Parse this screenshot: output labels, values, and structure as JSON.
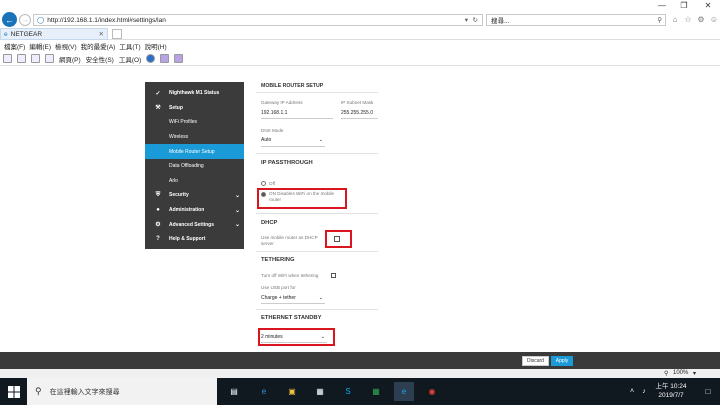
{
  "browser": {
    "url": "http://192.168.1.1/index.html#settings/lan",
    "search_placeholder": "搜尋...",
    "tab_title": "NETGEAR",
    "menu": [
      "檔案(F)",
      "編輯(E)",
      "檢視(V)",
      "我的最愛(A)",
      "工具(T)",
      "說明(H)"
    ],
    "commands": {
      "page": "網頁(P)",
      "safety": "安全性(S)",
      "tools": "工具(O)"
    },
    "zoom": "100%",
    "window_controls": {
      "minimize": "—",
      "maximize": "❐",
      "close": "✕"
    }
  },
  "sidebar": {
    "items": [
      {
        "label": "Nighthawk M1 Status",
        "icon": "status-icon"
      },
      {
        "label": "Setup",
        "icon": "wrench-icon"
      },
      {
        "label": "WiFi Profiles"
      },
      {
        "label": "Wireless"
      },
      {
        "label": "Mobile Router Setup"
      },
      {
        "label": "Data Offloading"
      },
      {
        "label": "Arlo"
      },
      {
        "label": "Security",
        "icon": "shield-icon"
      },
      {
        "label": "Administration",
        "icon": "user-icon"
      },
      {
        "label": "Advanced Settings",
        "icon": "gear-icon"
      },
      {
        "label": "Help & Support",
        "icon": "help-icon"
      }
    ]
  },
  "content": {
    "title": "MOBILE ROUTER SETUP",
    "gateway_label": "Gateway IP Address",
    "gateway_value": "192.168.1.1",
    "subnet_label": "IP Subnet Mask",
    "subnet_value": "255.255.255.0",
    "dns_label": "DNS Mode",
    "dns_value": "Auto",
    "passthrough_title": "IP PASSTHROUGH",
    "passthrough_off": "Off",
    "passthrough_on": "ON Disables WiFi on the mobile router",
    "dhcp_title": "DHCP",
    "dhcp_label": "Use mobile router as DHCP server",
    "tethering_title": "TETHERING",
    "tethering_label": "Turn off WiFi when tethering",
    "usb_label": "Use USB port for",
    "usb_value": "Charge + tether",
    "standby_title": "ETHERNET STANDBY",
    "standby_value": "2 minutes"
  },
  "footer": {
    "discard": "Discard",
    "apply": "Apply"
  },
  "taskbar": {
    "search_placeholder": "在這裡輸入文字來搜尋",
    "time": "上午 10:24",
    "date": "2019/7/7"
  },
  "colors": {
    "accent": "#1a9bd7",
    "sidebar": "#3b3b3b",
    "highlight": "#d9161d"
  }
}
